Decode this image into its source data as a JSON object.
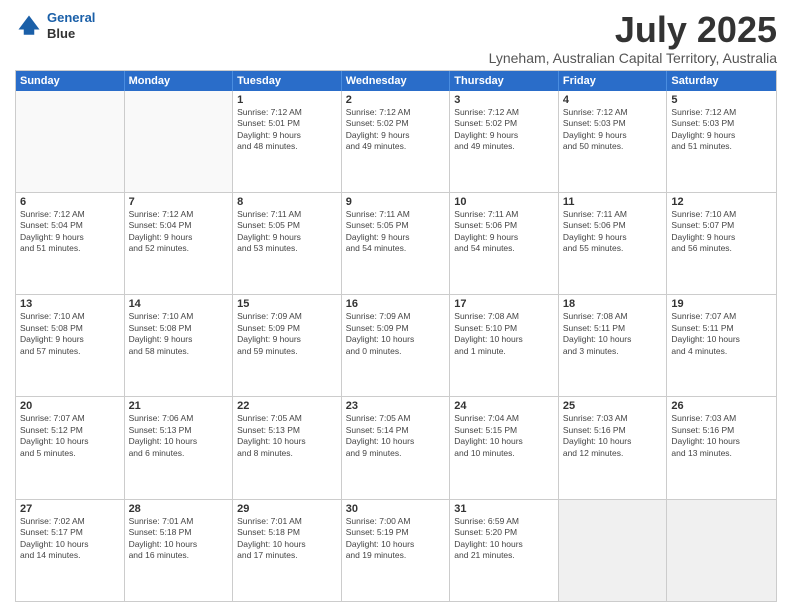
{
  "header": {
    "logo_line1": "General",
    "logo_line2": "Blue",
    "month_title": "July 2025",
    "subtitle": "Lyneham, Australian Capital Territory, Australia"
  },
  "days_of_week": [
    "Sunday",
    "Monday",
    "Tuesday",
    "Wednesday",
    "Thursday",
    "Friday",
    "Saturday"
  ],
  "weeks": [
    [
      {
        "day": "",
        "info": ""
      },
      {
        "day": "",
        "info": ""
      },
      {
        "day": "1",
        "info": "Sunrise: 7:12 AM\nSunset: 5:01 PM\nDaylight: 9 hours\nand 48 minutes."
      },
      {
        "day": "2",
        "info": "Sunrise: 7:12 AM\nSunset: 5:02 PM\nDaylight: 9 hours\nand 49 minutes."
      },
      {
        "day": "3",
        "info": "Sunrise: 7:12 AM\nSunset: 5:02 PM\nDaylight: 9 hours\nand 49 minutes."
      },
      {
        "day": "4",
        "info": "Sunrise: 7:12 AM\nSunset: 5:03 PM\nDaylight: 9 hours\nand 50 minutes."
      },
      {
        "day": "5",
        "info": "Sunrise: 7:12 AM\nSunset: 5:03 PM\nDaylight: 9 hours\nand 51 minutes."
      }
    ],
    [
      {
        "day": "6",
        "info": "Sunrise: 7:12 AM\nSunset: 5:04 PM\nDaylight: 9 hours\nand 51 minutes."
      },
      {
        "day": "7",
        "info": "Sunrise: 7:12 AM\nSunset: 5:04 PM\nDaylight: 9 hours\nand 52 minutes."
      },
      {
        "day": "8",
        "info": "Sunrise: 7:11 AM\nSunset: 5:05 PM\nDaylight: 9 hours\nand 53 minutes."
      },
      {
        "day": "9",
        "info": "Sunrise: 7:11 AM\nSunset: 5:05 PM\nDaylight: 9 hours\nand 54 minutes."
      },
      {
        "day": "10",
        "info": "Sunrise: 7:11 AM\nSunset: 5:06 PM\nDaylight: 9 hours\nand 54 minutes."
      },
      {
        "day": "11",
        "info": "Sunrise: 7:11 AM\nSunset: 5:06 PM\nDaylight: 9 hours\nand 55 minutes."
      },
      {
        "day": "12",
        "info": "Sunrise: 7:10 AM\nSunset: 5:07 PM\nDaylight: 9 hours\nand 56 minutes."
      }
    ],
    [
      {
        "day": "13",
        "info": "Sunrise: 7:10 AM\nSunset: 5:08 PM\nDaylight: 9 hours\nand 57 minutes."
      },
      {
        "day": "14",
        "info": "Sunrise: 7:10 AM\nSunset: 5:08 PM\nDaylight: 9 hours\nand 58 minutes."
      },
      {
        "day": "15",
        "info": "Sunrise: 7:09 AM\nSunset: 5:09 PM\nDaylight: 9 hours\nand 59 minutes."
      },
      {
        "day": "16",
        "info": "Sunrise: 7:09 AM\nSunset: 5:09 PM\nDaylight: 10 hours\nand 0 minutes."
      },
      {
        "day": "17",
        "info": "Sunrise: 7:08 AM\nSunset: 5:10 PM\nDaylight: 10 hours\nand 1 minute."
      },
      {
        "day": "18",
        "info": "Sunrise: 7:08 AM\nSunset: 5:11 PM\nDaylight: 10 hours\nand 3 minutes."
      },
      {
        "day": "19",
        "info": "Sunrise: 7:07 AM\nSunset: 5:11 PM\nDaylight: 10 hours\nand 4 minutes."
      }
    ],
    [
      {
        "day": "20",
        "info": "Sunrise: 7:07 AM\nSunset: 5:12 PM\nDaylight: 10 hours\nand 5 minutes."
      },
      {
        "day": "21",
        "info": "Sunrise: 7:06 AM\nSunset: 5:13 PM\nDaylight: 10 hours\nand 6 minutes."
      },
      {
        "day": "22",
        "info": "Sunrise: 7:05 AM\nSunset: 5:13 PM\nDaylight: 10 hours\nand 8 minutes."
      },
      {
        "day": "23",
        "info": "Sunrise: 7:05 AM\nSunset: 5:14 PM\nDaylight: 10 hours\nand 9 minutes."
      },
      {
        "day": "24",
        "info": "Sunrise: 7:04 AM\nSunset: 5:15 PM\nDaylight: 10 hours\nand 10 minutes."
      },
      {
        "day": "25",
        "info": "Sunrise: 7:03 AM\nSunset: 5:16 PM\nDaylight: 10 hours\nand 12 minutes."
      },
      {
        "day": "26",
        "info": "Sunrise: 7:03 AM\nSunset: 5:16 PM\nDaylight: 10 hours\nand 13 minutes."
      }
    ],
    [
      {
        "day": "27",
        "info": "Sunrise: 7:02 AM\nSunset: 5:17 PM\nDaylight: 10 hours\nand 14 minutes."
      },
      {
        "day": "28",
        "info": "Sunrise: 7:01 AM\nSunset: 5:18 PM\nDaylight: 10 hours\nand 16 minutes."
      },
      {
        "day": "29",
        "info": "Sunrise: 7:01 AM\nSunset: 5:18 PM\nDaylight: 10 hours\nand 17 minutes."
      },
      {
        "day": "30",
        "info": "Sunrise: 7:00 AM\nSunset: 5:19 PM\nDaylight: 10 hours\nand 19 minutes."
      },
      {
        "day": "31",
        "info": "Sunrise: 6:59 AM\nSunset: 5:20 PM\nDaylight: 10 hours\nand 21 minutes."
      },
      {
        "day": "",
        "info": ""
      },
      {
        "day": "",
        "info": ""
      }
    ]
  ]
}
